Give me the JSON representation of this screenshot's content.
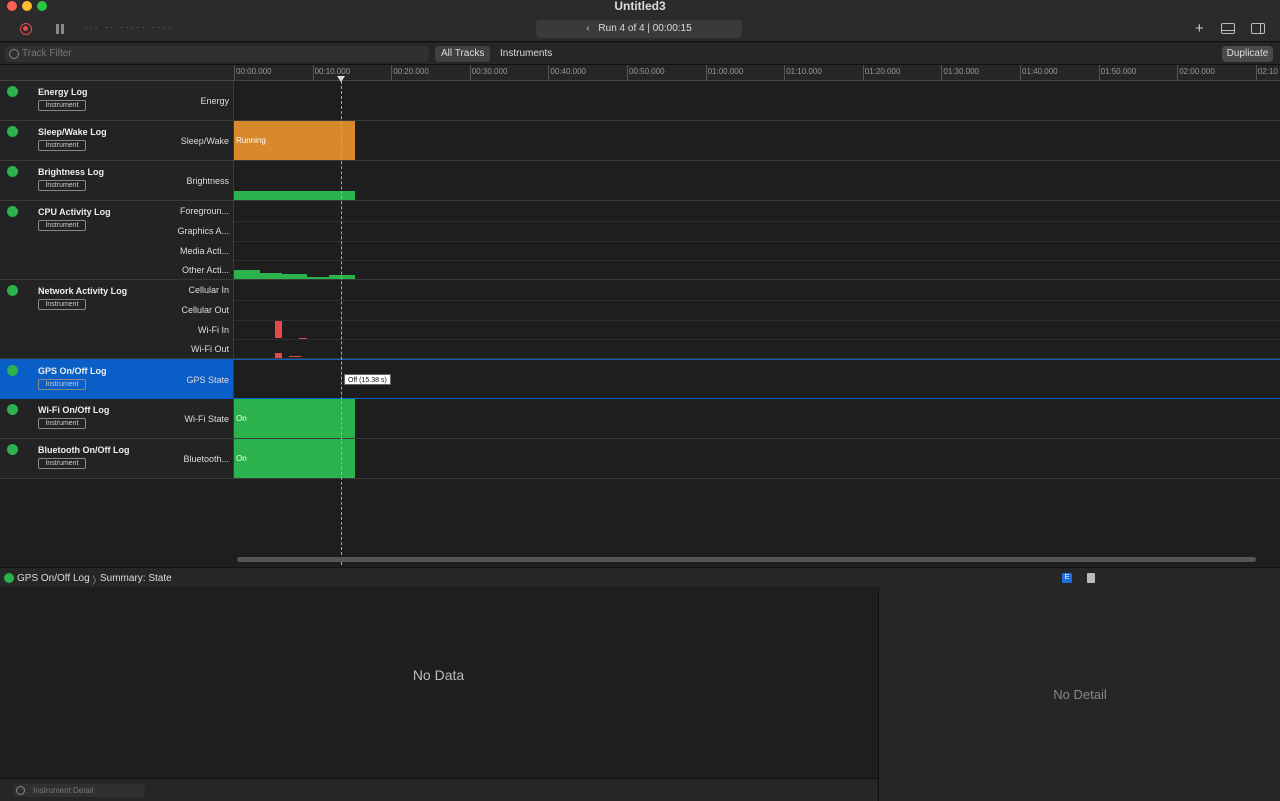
{
  "window": {
    "title": "Untitled3"
  },
  "toolbar": {
    "target": "··· ·· ····· ····",
    "run_label": "Run 4 of 4",
    "run_separator": "|",
    "run_time": "00:00:15",
    "add_icon": "+"
  },
  "filterbar": {
    "placeholder": "Track Filter",
    "all_tracks": "All Tracks",
    "instruments": "Instruments",
    "duplicate": "Duplicate"
  },
  "ruler": {
    "ticks": [
      "00:00.000",
      "00:10.000",
      "00:20.000",
      "00:30.000",
      "00:40.000",
      "00:50.000",
      "01:00.000",
      "01:10.000",
      "01:20.000",
      "01:30.000",
      "01:40.000",
      "01:50.000",
      "02:00.000",
      "02:10"
    ]
  },
  "badge": "Instrument",
  "tracks": [
    {
      "name": "Energy Log",
      "lanes": [
        "Energy"
      ]
    },
    {
      "name": "Sleep/Wake Log",
      "lanes": [
        "Sleep/Wake"
      ],
      "bar_text": "Running",
      "bar_color": "#d7892b"
    },
    {
      "name": "Brightness Log",
      "lanes": [
        "Brightness"
      ],
      "bar_color": "#2bb24c"
    },
    {
      "name": "CPU Activity Log",
      "lanes": [
        "Foregroun...",
        "Graphics A...",
        "Media Acti...",
        "Other Acti..."
      ]
    },
    {
      "name": "Network Activity Log",
      "lanes": [
        "Cellular In",
        "Cellular Out",
        "Wi-Fi In",
        "Wi-Fi Out"
      ],
      "bar_color": "#e5484d"
    },
    {
      "name": "GPS On/Off Log",
      "lanes": [
        "GPS State"
      ],
      "tooltip": "Off (15.38 s)"
    },
    {
      "name": "Wi-Fi On/Off Log",
      "lanes": [
        "Wi-Fi State"
      ],
      "bar_text": "On",
      "bar_color": "#2bb24c"
    },
    {
      "name": "Bluetooth On/Off Log",
      "lanes": [
        "Bluetooth..."
      ],
      "bar_text": "On",
      "bar_color": "#2bb24c"
    }
  ],
  "detail": {
    "instrument": "GPS On/Off Log",
    "separator": "〉",
    "view": "Summary: State",
    "empty": "No Data",
    "side_empty": "No Detail",
    "filter_placeholder": "Instrument Detail",
    "ext_icon_letter": "E"
  }
}
